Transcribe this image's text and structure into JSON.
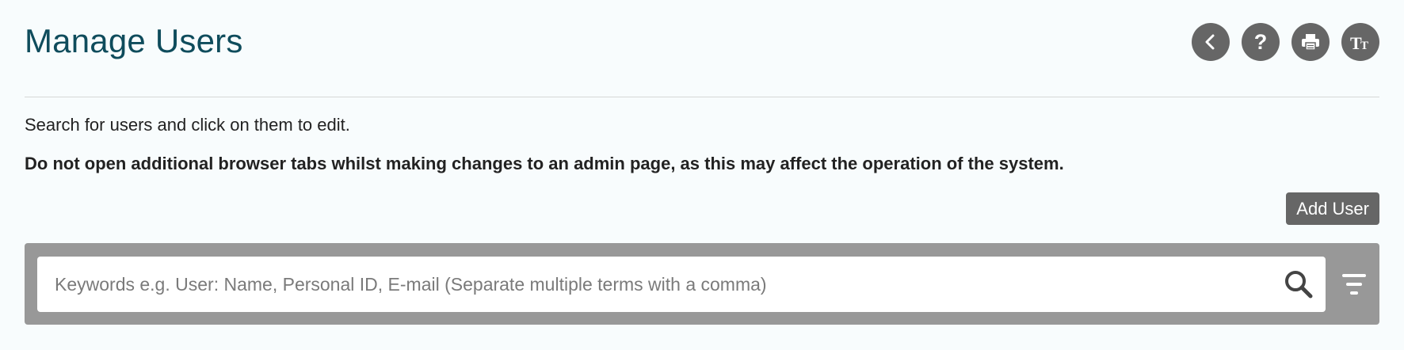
{
  "header": {
    "title": "Manage Users",
    "icons": {
      "back": "chevron-left-icon",
      "help": "question-icon",
      "print": "printer-icon",
      "text_size": "text-size-icon"
    },
    "icon_button_color": "#666666",
    "title_color": "#0f4c5c"
  },
  "content": {
    "intro": "Search for users and click on them to edit.",
    "warning": "Do not open additional browser tabs whilst making changes to an admin page, as this may affect the operation of the system."
  },
  "actions": {
    "add_user_label": "Add User"
  },
  "search": {
    "placeholder": "Keywords e.g. User: Name, Personal ID, E-mail (Separate multiple terms with a comma)",
    "value": "",
    "search_icon": "search-icon",
    "filter_icon": "filter-icon",
    "panel_color": "#989898"
  }
}
